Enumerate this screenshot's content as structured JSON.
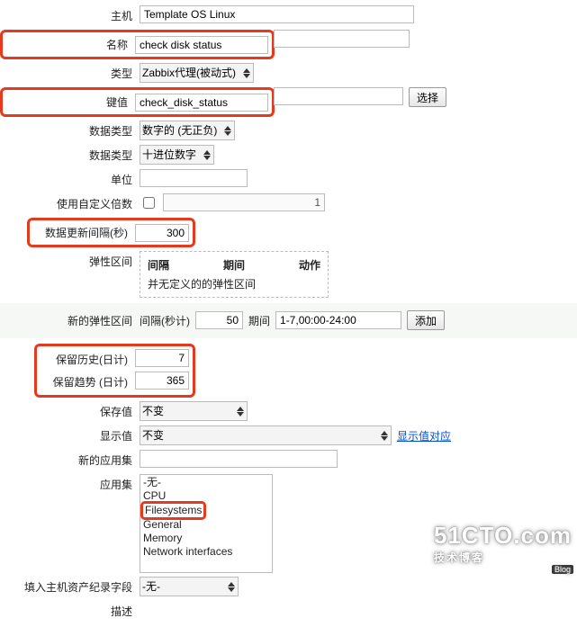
{
  "labels": {
    "host": "主机",
    "name": "名称",
    "type": "类型",
    "key": "键值",
    "data_type": "数据类型",
    "data_type2": "数据类型",
    "units": "单位",
    "custom_multiplier": "使用自定义倍数",
    "update_interval": "数据更新间隔(秒)",
    "flex": "弹性区间",
    "flex_interval": "间隔",
    "flex_period": "期间",
    "flex_action": "动作",
    "flex_none": "并无定义的的弹性区间",
    "new_flex": "新的弹性区间",
    "new_flex_interval": "间隔(秒计)",
    "new_flex_period": "期间",
    "add": "添加",
    "keep_history": "保留历史(日计)",
    "keep_trends": "保留趋势 (日计)",
    "store": "保存值",
    "display": "显示值",
    "show_mapping": "显示值对应",
    "new_app": "新的应用集",
    "apps": "应用集",
    "inventory": "填入主机资产纪录字段",
    "description": "描述",
    "select": "选择"
  },
  "values": {
    "host": "Template OS Linux",
    "name": "check disk status",
    "type": "Zabbix代理(被动式)",
    "key": "check_disk_status",
    "data_type": "数字的 (无正负)",
    "data_type2": "十进位数字",
    "units": "",
    "custom_multiplier_value": "1",
    "update_interval": "300",
    "new_flex_interval": "50",
    "new_flex_period": "1-7,00:00-24:00",
    "keep_history": "7",
    "keep_trends": "365",
    "store": "不变",
    "display": "不变",
    "new_app": "",
    "inventory": "-无-"
  },
  "apps": {
    "items": [
      "-无-",
      "CPU",
      "Filesystems",
      "General",
      "Memory",
      "Network interfaces"
    ],
    "highlighted": "Filesystems"
  },
  "watermark": {
    "big": "51CTO.com",
    "sub": "技术博客",
    "tag": "Blog"
  }
}
